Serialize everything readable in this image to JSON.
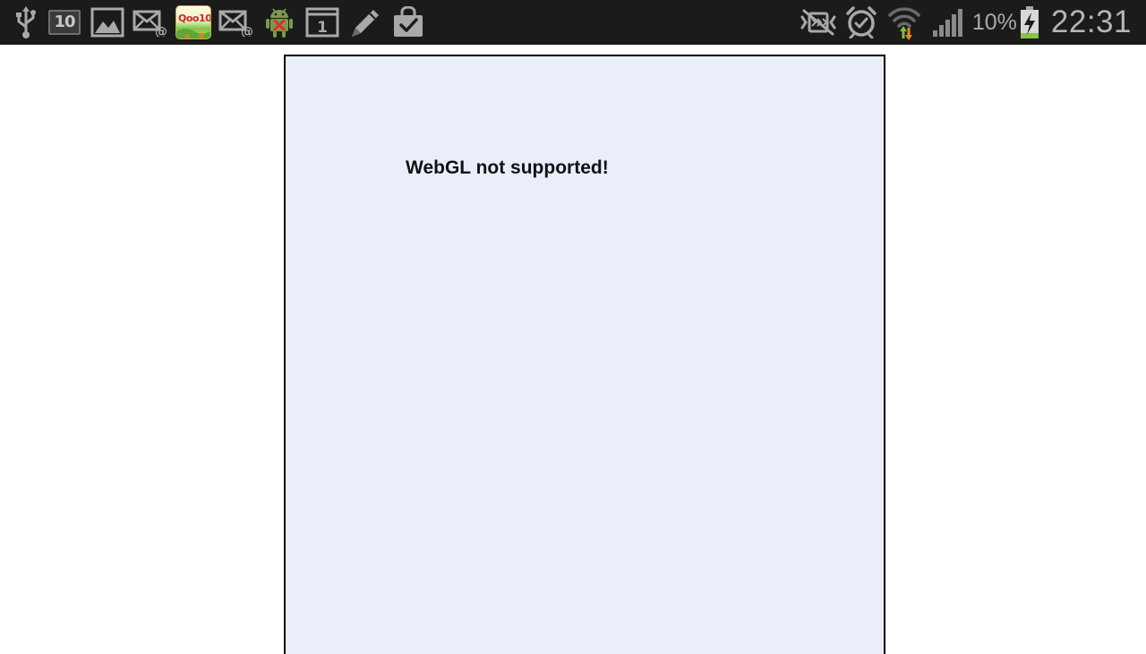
{
  "status_bar": {
    "notification_icons": [
      {
        "icon": "usb-icon"
      },
      {
        "icon": "notification-count-icon",
        "text": "10"
      },
      {
        "icon": "gallery-image-icon"
      },
      {
        "icon": "email-icon"
      },
      {
        "icon": "qoo10-app-icon",
        "text": "Qoo10"
      },
      {
        "icon": "email-icon"
      },
      {
        "icon": "android-debug-icon"
      },
      {
        "icon": "calendar-icon",
        "text": "1"
      },
      {
        "icon": "edit-pencil-icon"
      },
      {
        "icon": "shopping-bag-check-icon"
      }
    ],
    "system_icons": [
      {
        "icon": "vibrate-mute-icon"
      },
      {
        "icon": "alarm-clock-icon"
      },
      {
        "icon": "wifi-icon"
      },
      {
        "icon": "cell-signal-icon"
      }
    ],
    "battery_percent": "10%",
    "time": "22:31",
    "colors": {
      "background": "#1b1b1b",
      "icon": "#a9a9a9",
      "battery_low": "#8ac43f",
      "wifi_up": "#f08a24",
      "wifi_down": "#7cc23a"
    }
  },
  "content": {
    "message": "WebGL not supported!",
    "colors": {
      "page_background": "#ffffff",
      "canvas_background": "#eaeefb",
      "canvas_border": "#000000"
    }
  }
}
